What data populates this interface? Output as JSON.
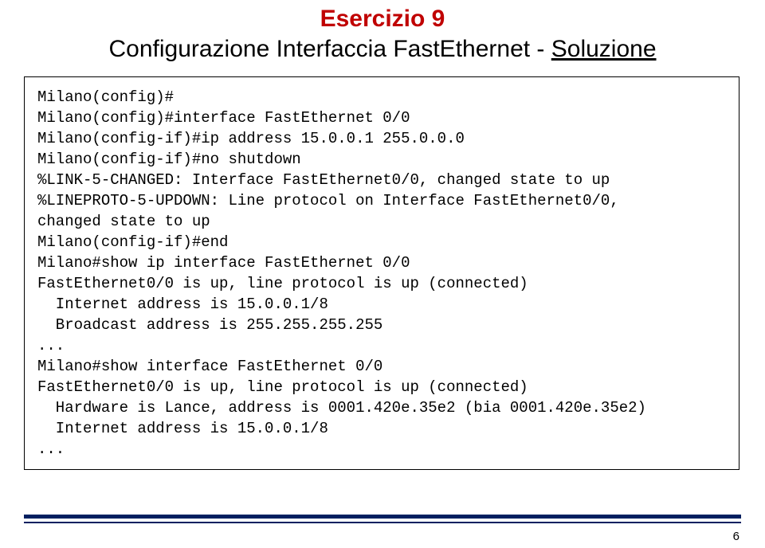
{
  "header": {
    "exercise": "Esercizio 9",
    "subtitle_prefix": "Configurazione Interfaccia FastEthernet - ",
    "subtitle_soluzione": "Soluzione"
  },
  "code": {
    "l01": "Milano(config)#",
    "l02": "Milano(config)#interface FastEthernet 0/0",
    "l03": "Milano(config-if)#ip address 15.0.0.1 255.0.0.0",
    "l04": "Milano(config-if)#no shutdown",
    "l05": "%LINK-5-CHANGED: Interface FastEthernet0/0, changed state to up",
    "l06": "%LINEPROTO-5-UPDOWN: Line protocol on Interface FastEthernet0/0,",
    "l07": "changed state to up",
    "l08": "Milano(config-if)#end",
    "l09": "Milano#show ip interface FastEthernet 0/0",
    "l10": "FastEthernet0/0 is up, line protocol is up (connected)",
    "l11": "  Internet address is 15.0.0.1/8",
    "l12": "  Broadcast address is 255.255.255.255",
    "l13": "...",
    "l14": "Milano#show interface FastEthernet 0/0",
    "l15": "FastEthernet0/0 is up, line protocol is up (connected)",
    "l16": "  Hardware is Lance, address is 0001.420e.35e2 (bia 0001.420e.35e2)",
    "l17": "  Internet address is 15.0.0.1/8",
    "l18": "..."
  },
  "footer": {
    "page_number": "6"
  }
}
